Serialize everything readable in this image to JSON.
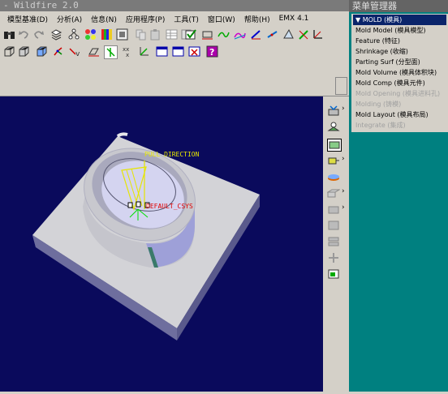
{
  "window": {
    "title": "- Wildfire 2.0"
  },
  "menubar": [
    "模型基准(D)",
    "分析(A)",
    "信息(N)",
    "应用程序(P)",
    "工具(T)",
    "窗口(W)",
    "帮助(H)",
    "EMX 4.1"
  ],
  "icons": {
    "toolbar1": [
      "binoculars-icon",
      "undo-icon",
      "redo-icon",
      "layers-icon",
      "tree-icon",
      "color-palette-icon",
      "color-bars-icon",
      "repaint-icon",
      "copy-icon",
      "paste-icon",
      "table-icon",
      "format-icon",
      "check-icon",
      "datum-plane-icon",
      "curve-icon",
      "surface-icon",
      "sketch-icon",
      "point-icon",
      "plane-icon",
      "axis-icon",
      "csys-icon"
    ],
    "toolbar2": [
      "box-icon",
      "cube-icon",
      "axis-node-icon",
      "point-dropdown-icon",
      "plane-display-icon",
      "axis-display-icon",
      "point-display-icon",
      "csys-display-icon",
      "window-icon",
      "close-window-icon",
      "help-icon"
    ],
    "righttools": [
      "mold-volume-icon",
      "shrink-icon",
      "parting-surface-icon",
      "sliding-icon",
      "split-icon",
      "mold-component-icon",
      "cast-icon",
      "ejector-icon",
      "mold-opening-icon",
      "drawing-icon"
    ]
  },
  "viewport": {
    "pull_direction_label": "PULL DIRECTION",
    "csys_label": "DEFAULT_CSYS"
  },
  "menu_manager": {
    "title": "菜单管理器",
    "header": "MOLD (模具)",
    "items": [
      {
        "label": "Mold Model (模具模型)",
        "enabled": true
      },
      {
        "label": "Feature (特征)",
        "enabled": true
      },
      {
        "label": "Shrinkage (收缩)",
        "enabled": true
      },
      {
        "label": "Parting Surf (分型面)",
        "enabled": true
      },
      {
        "label": "Mold Volume (模具体积块)",
        "enabled": true
      },
      {
        "label": "Mold Comp (模具元件)",
        "enabled": true
      },
      {
        "label": "Mold Opening (模具进料孔)",
        "enabled": false
      },
      {
        "label": "Molding (铸模)",
        "enabled": false
      },
      {
        "label": "Mold Layout (模具布局)",
        "enabled": true
      },
      {
        "label": "Integrate (集成)",
        "enabled": false
      }
    ]
  }
}
